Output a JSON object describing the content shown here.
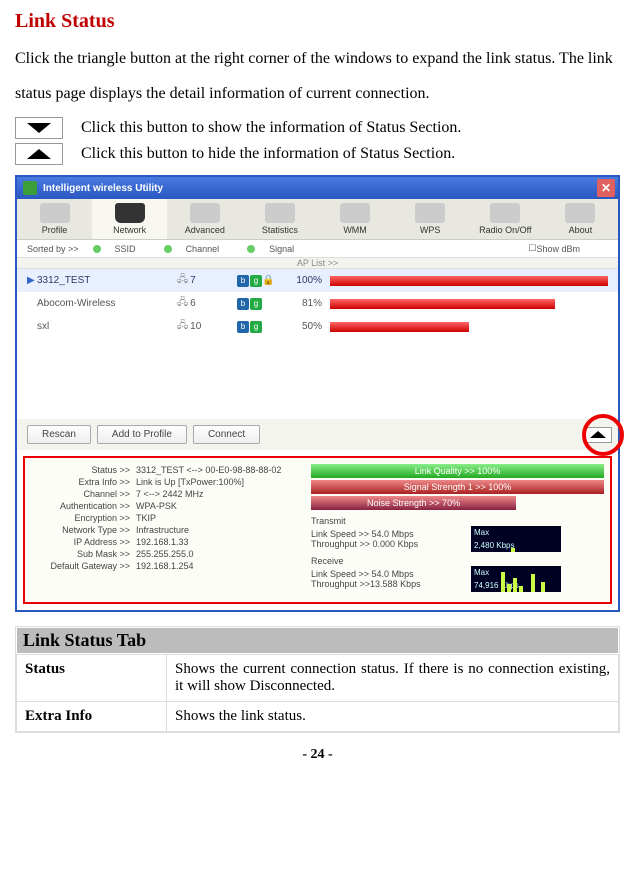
{
  "title": "Link Status",
  "intro": "Click the triangle button at the right corner of the windows to expand the link status. The link status page displays the detail information of current connection.",
  "btn_down_desc": "Click this button to show the information of Status Section.",
  "btn_up_desc": "Click this button to hide the information of Status Section.",
  "app": {
    "window_title": "Intelligent wireless Utility",
    "toolbar": [
      "Profile",
      "Network",
      "Advanced",
      "Statistics",
      "WMM",
      "WPS",
      "Radio On/Off",
      "About"
    ],
    "sort_by": "Sorted by >>",
    "sort_ssid": "SSID",
    "sort_channel": "Channel",
    "sort_signal": "Signal",
    "show_dbm": "Show dBm",
    "ap_list_hdr": "AP List >>",
    "rows": [
      {
        "ssid": "3312_TEST",
        "ch": "7",
        "signal": "100%",
        "bar": 100,
        "lock": true,
        "sel": true
      },
      {
        "ssid": "Abocom-Wireless",
        "ch": "6",
        "signal": "81%",
        "bar": 81,
        "lock": false,
        "sel": false
      },
      {
        "ssid": "sxl",
        "ch": "10",
        "signal": "50%",
        "bar": 50,
        "lock": false,
        "sel": false
      }
    ],
    "buttons": {
      "rescan": "Rescan",
      "add": "Add to Profile",
      "connect": "Connect"
    },
    "status": {
      "Status >>": "3312_TEST <--> 00-E0-98-88-88-02",
      "Extra Info >>": "Link is Up [TxPower:100%]",
      "Channel >>": "7 <--> 2442 MHz",
      "Authentication >>": "WPA-PSK",
      "Encryption >>": "TKIP",
      "Network Type >>": "Infrastructure",
      "IP Address >>": "192.168.1.33",
      "Sub Mask >>": "255.255.255.0",
      "Default Gateway >>": "192.168.1.254"
    },
    "quality": {
      "link": "Link Quality >> 100%",
      "sig1": "Signal Strength 1 >> 100%",
      "noise": "Noise Strength >> 70%"
    },
    "transmit_label": "Transmit",
    "receive_label": "Receive",
    "tx_speed": "Link Speed >> 54.0 Mbps",
    "tx_thr": "Throughput >> 0.000 Kbps",
    "rx_speed": "Link Speed >> 54.0 Mbps",
    "rx_thr": "Throughput >>13.588 Kbps",
    "tx_spark": {
      "label": "Max",
      "value": "2,480 Kbps"
    },
    "rx_spark": {
      "label": "Max",
      "value": "74,916 Kbps"
    }
  },
  "table_hdr": "Link Status Tab",
  "table_rows": [
    {
      "k": "Status",
      "v": "Shows the current connection status. If there is no connection existing, it will show Disconnected."
    },
    {
      "k": "Extra Info",
      "v": "Shows the link status."
    }
  ],
  "page": "- 24 -"
}
